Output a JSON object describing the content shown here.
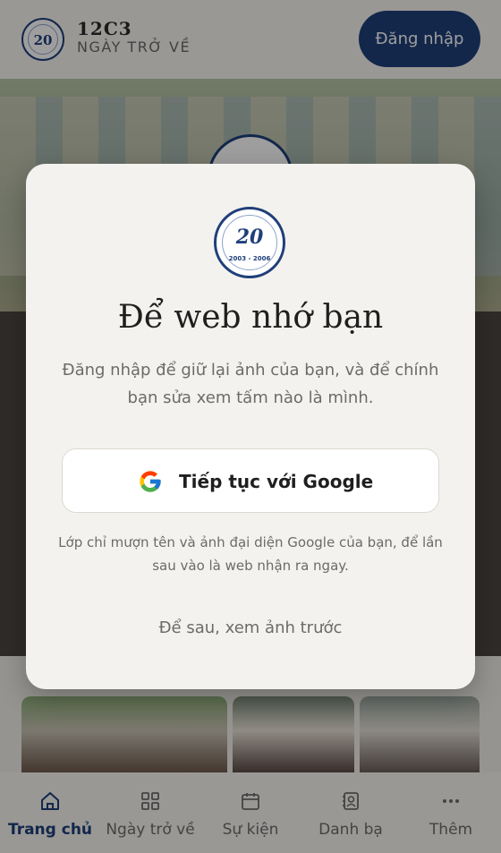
{
  "header": {
    "title": "12C3",
    "subtitle": "NGÀY TRỞ VỀ",
    "login_label": "Đăng nhập",
    "logo_text": "20"
  },
  "modal": {
    "logo": {
      "number": "20",
      "years": "2003 - 2006"
    },
    "title": "Để web nhớ bạn",
    "description": "Đăng nhập để giữ lại ảnh của bạn, và để chính bạn sửa xem tấm nào là mình.",
    "google_button_label": "Tiếp tục với Google",
    "note": "Lớp chỉ mượn tên và ảnh đại diện Google của bạn, để lần sau vào là web nhận ra ngay.",
    "later_label": "Để sau, xem ảnh trước"
  },
  "bottom_nav": {
    "items": [
      {
        "label": "Trang chủ",
        "icon": "home-icon",
        "active": true
      },
      {
        "label": "Ngày trở về",
        "icon": "grid-icon",
        "active": false
      },
      {
        "label": "Sự kiện",
        "icon": "calendar-icon",
        "active": false
      },
      {
        "label": "Danh bạ",
        "icon": "contacts-icon",
        "active": false
      },
      {
        "label": "Thêm",
        "icon": "more-icon",
        "active": false
      }
    ]
  },
  "colors": {
    "primary": "#1f3f7a",
    "background": "#f2efe9",
    "modal_bg": "#f4f2ee"
  }
}
